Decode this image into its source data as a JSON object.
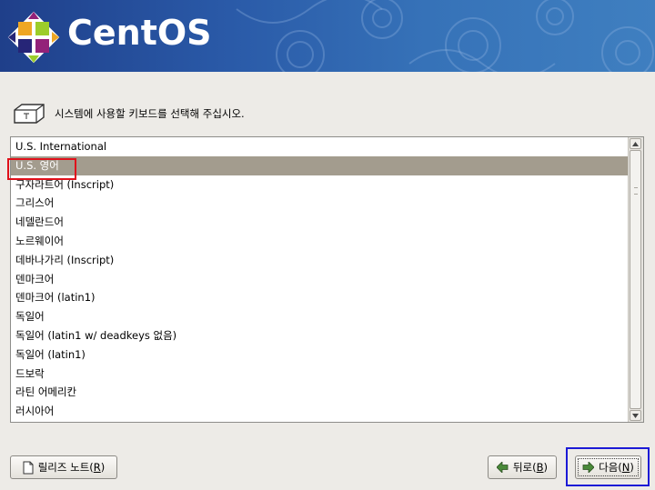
{
  "header": {
    "brand": "CentOS"
  },
  "prompt": {
    "text": "시스템에 사용할 키보드를 선택해 주십시오."
  },
  "keyboard_list": {
    "selected_index": 1,
    "items": [
      "U.S. International",
      "U.S. 영어",
      "구자라트어 (Inscript)",
      "그리스어",
      "네델란드어",
      "노르웨이어",
      "데바나가리 (Inscript)",
      "덴마크어",
      "덴마크어 (latin1)",
      "독일어",
      "독일어 (latin1 w/ deadkeys 없음)",
      "독일어 (latin1)",
      "드보락",
      "라틴 어메리칸",
      "러시아어"
    ]
  },
  "buttons": {
    "release_notes": {
      "label": "릴리즈 노트(",
      "mnemonic": "R",
      "suffix": ")"
    },
    "back": {
      "label": "뒤로(",
      "mnemonic": "B",
      "suffix": ")"
    },
    "next": {
      "label": "다음(",
      "mnemonic": "N",
      "suffix": ")"
    }
  },
  "colors": {
    "selection": "#a39c8e",
    "annotation_red": "#e0111b",
    "annotation_blue": "#1c1ad6"
  }
}
